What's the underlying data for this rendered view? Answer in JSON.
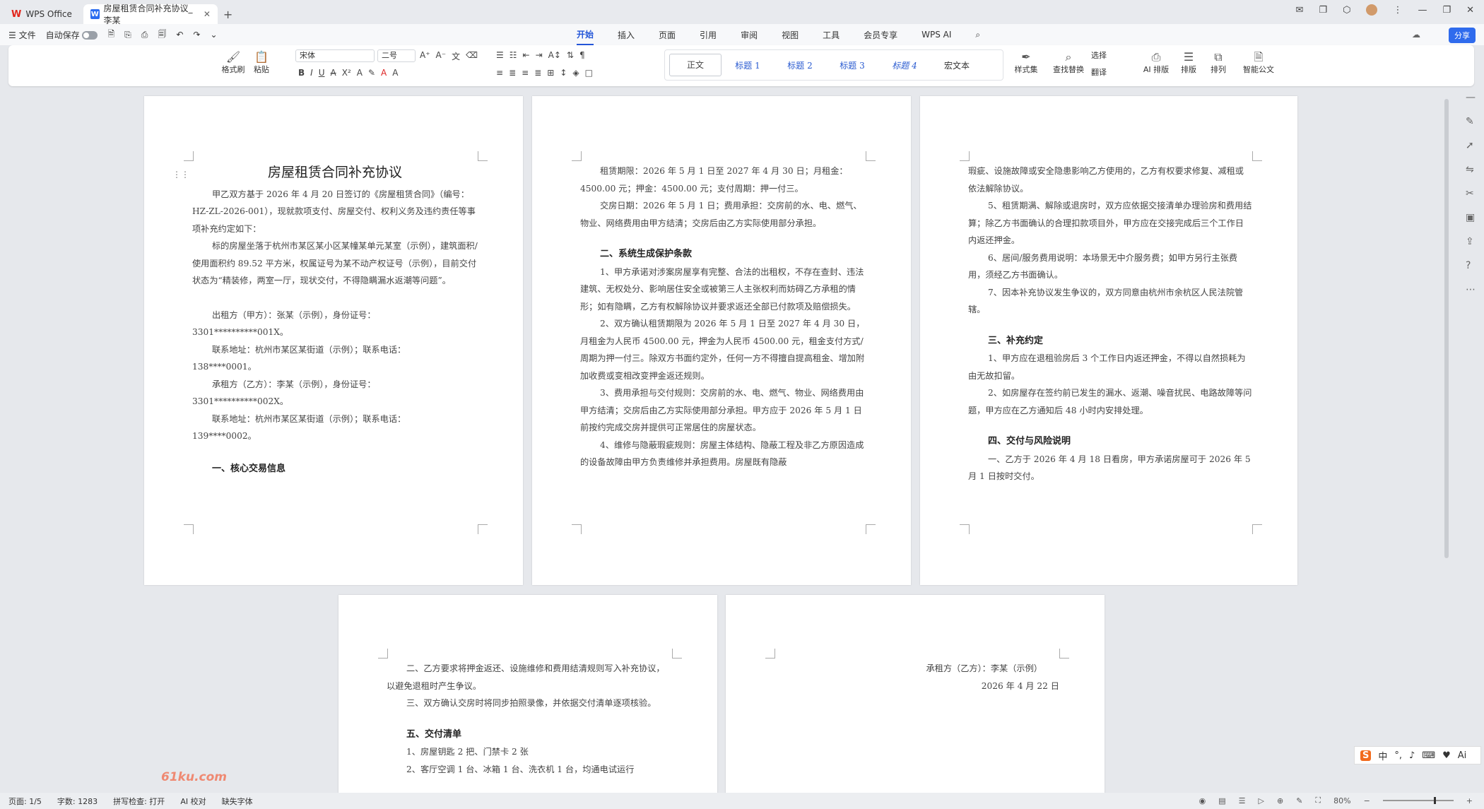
{
  "titlebar": {
    "home_tab": "WPS Office",
    "doc_tab": "房屋租赁合同补充协议_李某",
    "new_tab": "+"
  },
  "menubar": {
    "file": "文件",
    "autosave": "自动保存",
    "tabs": [
      "开始",
      "插入",
      "页面",
      "引用",
      "审阅",
      "视图",
      "工具",
      "会员专享",
      "WPS AI"
    ],
    "share": "分享"
  },
  "ribbon": {
    "format_painter": "格式刷",
    "paste": "粘贴",
    "font": "宋体",
    "size": "二号",
    "styles": [
      "正文",
      "标题 1",
      "标题 2",
      "标题 3",
      "标题 4",
      "宏文本"
    ],
    "style_set": "样式集",
    "find_replace": "查找替换",
    "select": "选择",
    "translate": "翻译",
    "ai_layout": "AI 排版",
    "layout": "排版",
    "arrange": "排列",
    "smart_doc": "智能公文"
  },
  "pages": {
    "p1": {
      "title": "房屋租赁合同补充协议",
      "paras": [
        "甲乙双方基于 2026 年 4 月 20 日签订的《房屋租赁合同》（编号：HZ-ZL-2026-001），现就款项支付、房屋交付、权利义务及违约责任等事项补充约定如下：",
        "标的房屋坐落于杭州市某区某小区某幢某单元某室（示例），建筑面积/使用面积约 89.52 平方米，权属证号为某不动产权证号（示例），目前交付状态为“精装修，两室一厅，现状交付，不得隐瞒漏水返潮等问题”。",
        "出租方（甲方）：张某（示例），身份证号：",
        "3301**********001X。",
        "联系地址：杭州市某区某街道（示例）；联系电话：",
        "138****0001。",
        "承租方（乙方）：李某（示例），身份证号：",
        "3301**********002X。",
        "联系地址：杭州市某区某街道（示例）；联系电话：",
        "139****0002。"
      ],
      "heading": "一、核心交易信息"
    },
    "p2": {
      "paras": [
        "租赁期限：2026 年 5 月 1 日至 2027 年 4 月 30 日；月租金：4500.00 元；押金：4500.00 元；支付周期：押一付三。",
        "交房日期：2026 年 5 月 1 日；费用承担：交房前的水、电、燃气、物业、网络费用由甲方结清；交房后由乙方实际使用部分承担。"
      ],
      "heading": "二、系统生成保护条款",
      "clauses": [
        "1、甲方承诺对涉案房屋享有完整、合法的出租权，不存在查封、违法建筑、无权处分、影响居住安全或被第三人主张权利而妨碍乙方承租的情形；如有隐瞒，乙方有权解除协议并要求返还全部已付款项及赔偿损失。",
        "2、双方确认租赁期限为 2026 年 5 月 1 日至 2027 年 4 月 30 日，月租金为人民币 4500.00 元，押金为人民币 4500.00 元，租金支付方式/周期为押一付三。除双方书面约定外，任何一方不得擅自提高租金、增加附加收费或变相改变押金返还规则。",
        "3、费用承担与交付规则：交房前的水、电、燃气、物业、网络费用由甲方结清；交房后由乙方实际使用部分承担。甲方应于 2026 年 5 月 1 日前按约完成交房并提供可正常居住的房屋状态。",
        "4、维修与隐蔽瑕疵规则：房屋主体结构、隐蔽工程及非乙方原因造成的设备故障由甲方负责维修并承担费用。房屋既有隐蔽"
      ]
    },
    "p3": {
      "paras": [
        "瑕疵、设施故障或安全隐患影响乙方使用的，乙方有权要求修复、减租或依法解除协议。",
        "5、租赁期满、解除或退房时，双方应依据交接清单办理验房和费用结算；除乙方书面确认的合理扣款项目外，甲方应在交接完成后三个工作日内返还押金。",
        "6、居间/服务费用说明：本场景无中介服务费；如甲方另行主张费用，须经乙方书面确认。",
        "7、因本补充协议发生争议的，双方同意由杭州市余杭区人民法院管辖。"
      ],
      "heading1": "三、补充约定",
      "paras2": [
        "1、甲方应在退租验房后 3 个工作日内返还押金，不得以自然损耗为由无故扣留。",
        "2、如房屋存在签约前已发生的漏水、返潮、噪音扰民、电路故障等问题，甲方应在乙方通知后 48 小时内安排处理。"
      ],
      "heading2": "四、交付与风险说明",
      "paras3": [
        "一、乙方于 2026 年 4 月 18 日看房，甲方承诺房屋可于 2026 年 5 月 1 日按时交付。"
      ]
    },
    "p4": {
      "paras": [
        "二、乙方要求将押金返还、设施维修和费用结清规则写入补充协议，以避免退租时产生争议。",
        "三、双方确认交房时将同步拍照录像，并依据交付清单逐项核验。"
      ],
      "heading": "五、交付清单",
      "items": [
        "1、房屋钥匙 2 把、门禁卡 2 张",
        "2、客厅空调 1 台、冰箱 1 台、洗衣机 1 台，均通电试运行"
      ]
    },
    "p5": {
      "sign": "承租方（乙方）：李某（示例）",
      "date": "2026 年 4 月 22 日"
    }
  },
  "statusbar": {
    "page": "页面: 1/5",
    "words": "字数: 1283",
    "spell": "拼写检查: 打开",
    "ai_proof": "AI 校对",
    "missing_font": "缺失字体",
    "zoom": "80%"
  },
  "ime": {
    "s": "S",
    "zh": "中"
  },
  "watermark": "61ku.com"
}
